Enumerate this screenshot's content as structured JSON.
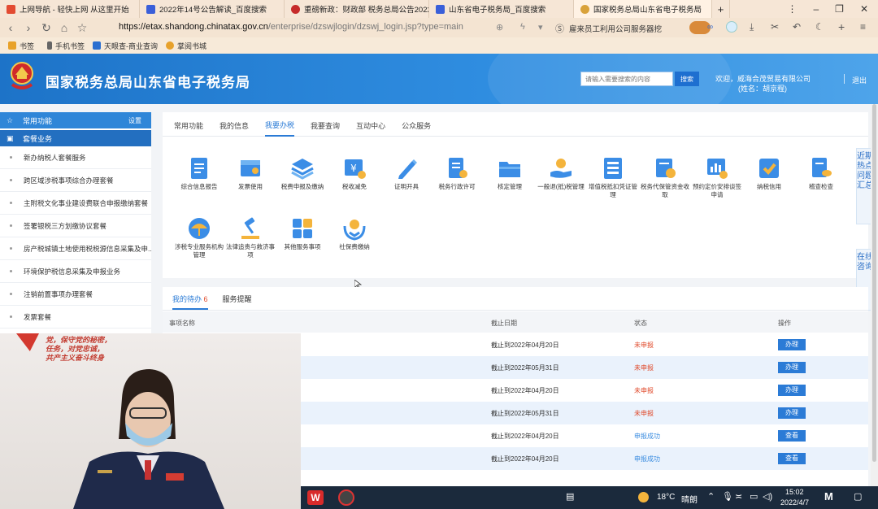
{
  "browser": {
    "tabs": [
      {
        "title": "上网导航 - 轻快上网 从这里开始",
        "color": "#e34b32"
      },
      {
        "title": "2022年14号公告解读_百度搜索",
        "color": "#3a5fd9"
      },
      {
        "title": "重磅新政：财政部 税务总局公告2022",
        "color": "#c62b2b"
      },
      {
        "title": "山东省电子税务局_百度搜索",
        "color": "#3a5fd9"
      },
      {
        "title": "国家税务总局山东省电子税务局",
        "color": "#d9a23a"
      }
    ],
    "url_domain": "https://etax.shandong.chinatax.gov.cn",
    "url_path": "/enterprise/dzswjlogin/dzswj_login.jsp?type=main",
    "ad_text": "雇来员工利用公司服务器挖",
    "bookmarks": [
      "书签",
      "手机书签",
      "天眼查-商业查询",
      "掌阅书城"
    ]
  },
  "header": {
    "site_title": "国家税务总局山东省电子税务局",
    "search_placeholder": "请输入需要搜索的内容",
    "search_button": "搜索",
    "welcome_line1": "欢迎，威海合茂贸易有限公司",
    "welcome_line2": "(姓名：胡京程)",
    "logout": "退出"
  },
  "sidebar": {
    "common_title": "常用功能",
    "settings": "设置",
    "package_title": "套餐业务",
    "items": [
      "新办纳税人套餐服务",
      "跨区域涉税事项综合办理套餐",
      "主附税文化事业建设费联合申报缴纳套餐",
      "签署银税三方划缴协议套餐",
      "房产税城镇土地使用税税源信息采集及申...",
      "环境保护税信息采集及申报业务",
      "注销前置事项办理套餐",
      "发票套餐"
    ]
  },
  "main_tabs": [
    {
      "label": "常用功能",
      "active": false
    },
    {
      "label": "我的信息",
      "active": false
    },
    {
      "label": "我要办税",
      "active": true
    },
    {
      "label": "我要查询",
      "active": false
    },
    {
      "label": "互动中心",
      "active": false
    },
    {
      "label": "公众服务",
      "active": false
    }
  ],
  "services": [
    {
      "label": "综合信息报告",
      "icon": "document-icon"
    },
    {
      "label": "发票使用",
      "icon": "invoice-icon"
    },
    {
      "label": "税费申报及缴纳",
      "icon": "layers-icon"
    },
    {
      "label": "税收减免",
      "icon": "tax-reduction-icon"
    },
    {
      "label": "证明开具",
      "icon": "pen-icon"
    },
    {
      "label": "税务行政许可",
      "icon": "permit-icon"
    },
    {
      "label": "核定管理",
      "icon": "folder-icon"
    },
    {
      "label": "一般退(抵)税管理",
      "icon": "refund-icon"
    },
    {
      "label": "增值税抵扣凭证管理",
      "icon": "voucher-icon"
    },
    {
      "label": "税务代保管资金收取",
      "icon": "custody-icon"
    },
    {
      "label": "预约定价安排谈签申请",
      "icon": "chart-icon"
    },
    {
      "label": "纳税信用",
      "icon": "credit-icon"
    },
    {
      "label": "稽查检查",
      "icon": "inspection-icon"
    },
    {
      "label": "涉税专业服务机构管理",
      "icon": "umbrella-icon"
    },
    {
      "label": "法律追责与救济事项",
      "icon": "gavel-icon"
    },
    {
      "label": "其他服务事项",
      "icon": "grid-icon"
    },
    {
      "label": "社保费缴纳",
      "icon": "social-security-icon"
    }
  ],
  "floaters": {
    "hot": "近期热点问题汇总",
    "consult": "在线咨询"
  },
  "todo": {
    "tab_todo": "我的待办",
    "tab_todo_count": "6",
    "tab_reminder": "服务提醒",
    "col_name": "事项名称",
    "col_deadline": "截止日期",
    "col_status": "状态",
    "col_op": "操作",
    "rows": [
      {
        "deadline": "截止到2022年04月20日",
        "status": "未申报",
        "op": "办理",
        "ok": false
      },
      {
        "deadline": "截止到2022年05月31日",
        "status": "未申报",
        "op": "办理",
        "ok": false
      },
      {
        "deadline": "截止到2022年04月20日",
        "status": "未申报",
        "op": "办理",
        "ok": false
      },
      {
        "deadline": "截止到2022年05月31日",
        "status": "未申报",
        "op": "办理",
        "ok": false
      },
      {
        "deadline": "截止到2022年04月20日",
        "status": "申报成功",
        "op": "查看",
        "ok": true
      },
      {
        "deadline": "截止到2022年04月20日",
        "status": "申报成功",
        "op": "查看",
        "ok": true
      }
    ]
  },
  "taskbar": {
    "temperature": "18°C",
    "weather": "晴朗",
    "time": "15:02",
    "date": "2022/4/7"
  },
  "video": {
    "wall_text_line1": "党，保守党的秘密，",
    "wall_text_line2": "任务，对党忠诚，",
    "wall_text_line3": "共产主义奋斗终身"
  },
  "colors": {
    "primary": "#2b7bd6",
    "pending": "#e04a2b",
    "success": "#3a8ce0"
  }
}
